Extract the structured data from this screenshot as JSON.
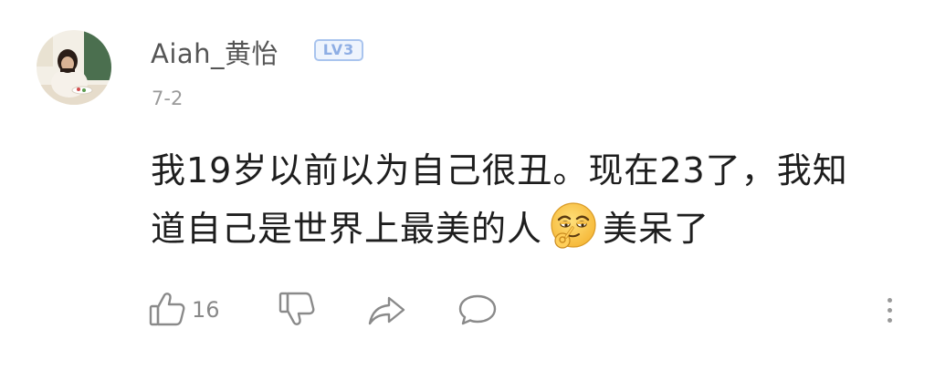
{
  "comment": {
    "username": "Aiah_黄怡",
    "level": "LV3",
    "date": "7-2",
    "text_line1": "我19岁以前以为自己很丑。现在23了，我知",
    "text_line2_before_emoji": "道自己是世界上最美的人",
    "emoji": "smug-ok-hand-emoji",
    "text_line2_after_emoji": "美呆了",
    "like_count": "16"
  },
  "colors": {
    "username": "#555555",
    "date": "#9a9a9a",
    "body_text": "#1e1e1e",
    "icon": "#8a8a8a",
    "level_badge": "#a9c4ee"
  },
  "icons": {
    "like": "thumbs-up-icon",
    "dislike": "thumbs-down-icon",
    "share": "share-arrow-icon",
    "reply": "speech-bubble-icon",
    "more": "more-vertical-icon"
  }
}
